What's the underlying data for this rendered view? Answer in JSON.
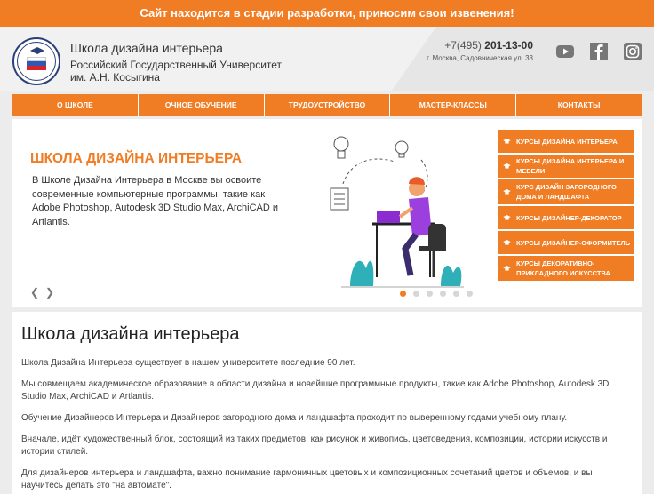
{
  "banner": "Сайт находится в стадии разработки, приносим свои извенения!",
  "header": {
    "school_title": "Школа дизайна интерьера",
    "university": "Российский Государственный Университет им. А.Н. Косыгина",
    "phone_prefix": "+7(495)",
    "phone_number": "201-13-00",
    "address": "г. Москва, Садовническая ул. 33"
  },
  "social": [
    "youtube-icon",
    "facebook-icon",
    "instagram-icon"
  ],
  "nav": [
    "О ШКОЛЕ",
    "ОЧНОЕ ОБУЧЕНИЕ",
    "ТРУДОУСТРОЙСТВО",
    "МАСТЕР-КЛАССЫ",
    "КОНТАКТЫ"
  ],
  "hero": {
    "title": "ШКОЛА ДИЗАЙНА ИНТЕРЬЕРА",
    "text": "В Школе Дизайна Интерьера в Москве вы освоите современные компьютерные программы, такие как Adobe Photoshop, Autodesk 3D Studio Max, ArchiCAD и Artlantis.",
    "slides": 6,
    "active_slide": 1
  },
  "courses": [
    "КУРСЫ ДИЗАЙНА ИНТЕРЬЕРА",
    "КУРСЫ ДИЗАЙНА ИНТЕРЬЕРА И МЕБЕЛИ",
    "КУРС ДИЗАЙН ЗАГОРОДНОГО ДОМА И ЛАНДШАФТА",
    "КУРСЫ ДИЗАЙНЕР-ДЕКОРАТОР",
    "КУРСЫ ДИЗАЙНЕР-ОФОРМИТЕЛЬ",
    "КУРСЫ ДЕКОРАТИВНО-ПРИКЛАДНОГО ИСКУССТВА"
  ],
  "main": {
    "heading": "Школа дизайна интерьера",
    "paragraphs": [
      "Школа Дизайна Интерьера существует в нашем университете последние 90 лет.",
      "Мы совмещаем академическое образование в области дизайна и новейшие программные продукты, такие как Adobe Photoshop, Autodesk 3D Studio Max, ArchiCAD и Artlantis.",
      "Обучение Дизайнеров Интерьера и Дизайнеров загородного дома и ландшафта проходит по выверенному годами учебному плану.",
      "Вначале, идёт художественный блок, состоящий из таких предметов, как рисунок и живопись, цветоведения, композиции, истории искусств и истории стилей.",
      "Для дизайнеров интерьера и ландшафта, важно понимание гармоничных цветовых и композиционных сочетаний цветов и объемов, и вы научитесь делать это \"на автомате\"."
    ]
  },
  "colors": {
    "accent": "#f07c24",
    "background": "#ececec"
  }
}
